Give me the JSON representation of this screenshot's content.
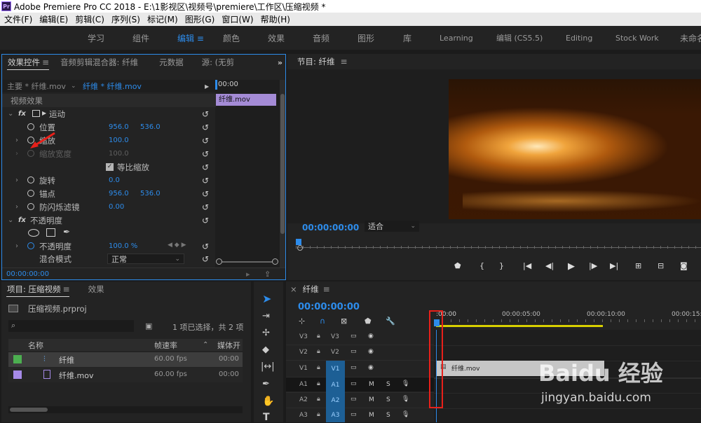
{
  "window": {
    "title": "Adobe Premiere Pro CC 2018 - E:\\1影视区\\视频号\\premiere\\工作区\\压缩视频 *",
    "logo": "Pr"
  },
  "menu": [
    "文件(F)",
    "编辑(E)",
    "剪辑(C)",
    "序列(S)",
    "标记(M)",
    "图形(G)",
    "窗口(W)",
    "帮助(H)"
  ],
  "workspaces": [
    "学习",
    "组件",
    "编辑",
    "颜色",
    "效果",
    "音频",
    "图形",
    "库",
    "Learning",
    "编辑 (CS5.5)",
    "Editing",
    "Stock Work",
    "未命名"
  ],
  "effect_controls": {
    "tabs": [
      "效果控件",
      "音频剪辑混合器: 纤维",
      "元数据",
      "源: (无剪"
    ],
    "master_clip": "主要 * 纤维.mov",
    "seq_clip": "纤维 * 纤维.mov",
    "timecode_start": "00:00",
    "clip_bar": "纤维.mov",
    "section_video": "视频效果",
    "motion": "运动",
    "position": {
      "label": "位置",
      "x": "956.0",
      "y": "536.0"
    },
    "scale": {
      "label": "缩放",
      "v": "100.0"
    },
    "scale_width": {
      "label": "缩放宽度",
      "v": "100.0"
    },
    "uniform_scale": "等比缩放",
    "rotation": {
      "label": "旋转",
      "v": "0.0"
    },
    "anchor": {
      "label": "锚点",
      "x": "956.0",
      "y": "536.0"
    },
    "antiflicker": {
      "label": "防闪烁滤镜",
      "v": "0.00"
    },
    "opacity_section": "不透明度",
    "opacity": {
      "label": "不透明度",
      "v": "100.0 %"
    },
    "blend": {
      "label": "混合模式",
      "v": "正常"
    },
    "timecode": "00:00:00:00",
    "fx": "fx"
  },
  "program": {
    "title": "节目: 纤维",
    "timecode": "00:00:00:00",
    "fit": "适合"
  },
  "project": {
    "tabs": [
      "项目: 压缩视频",
      "效果"
    ],
    "file": "压缩视频.prproj",
    "status": "1 项已选择，共 2 项",
    "columns": [
      "名称",
      "帧速率",
      "媒体开"
    ],
    "items": [
      {
        "color": "#4caf50",
        "name": "纤维",
        "fps": "60.00 fps",
        "start": "00:00"
      },
      {
        "color": "#a68ae8",
        "name": "纤维.mov",
        "fps": "60.00 fps",
        "start": "00:00"
      }
    ]
  },
  "timeline": {
    "title": "纤维",
    "timecode": "00:00:00:00",
    "ruler": [
      ":00:00",
      "00:00:05:00",
      "00:00:10:00",
      "00:00:15:0"
    ],
    "tracks_v": [
      "V3",
      "V2",
      "V1"
    ],
    "tracks_a": [
      "A1",
      "A2",
      "A3"
    ],
    "clip": "纤维.mov",
    "mute": "M",
    "solo": "S"
  },
  "watermark": {
    "brand": "Baidu 经验",
    "url": "jingyan.baidu.com"
  }
}
